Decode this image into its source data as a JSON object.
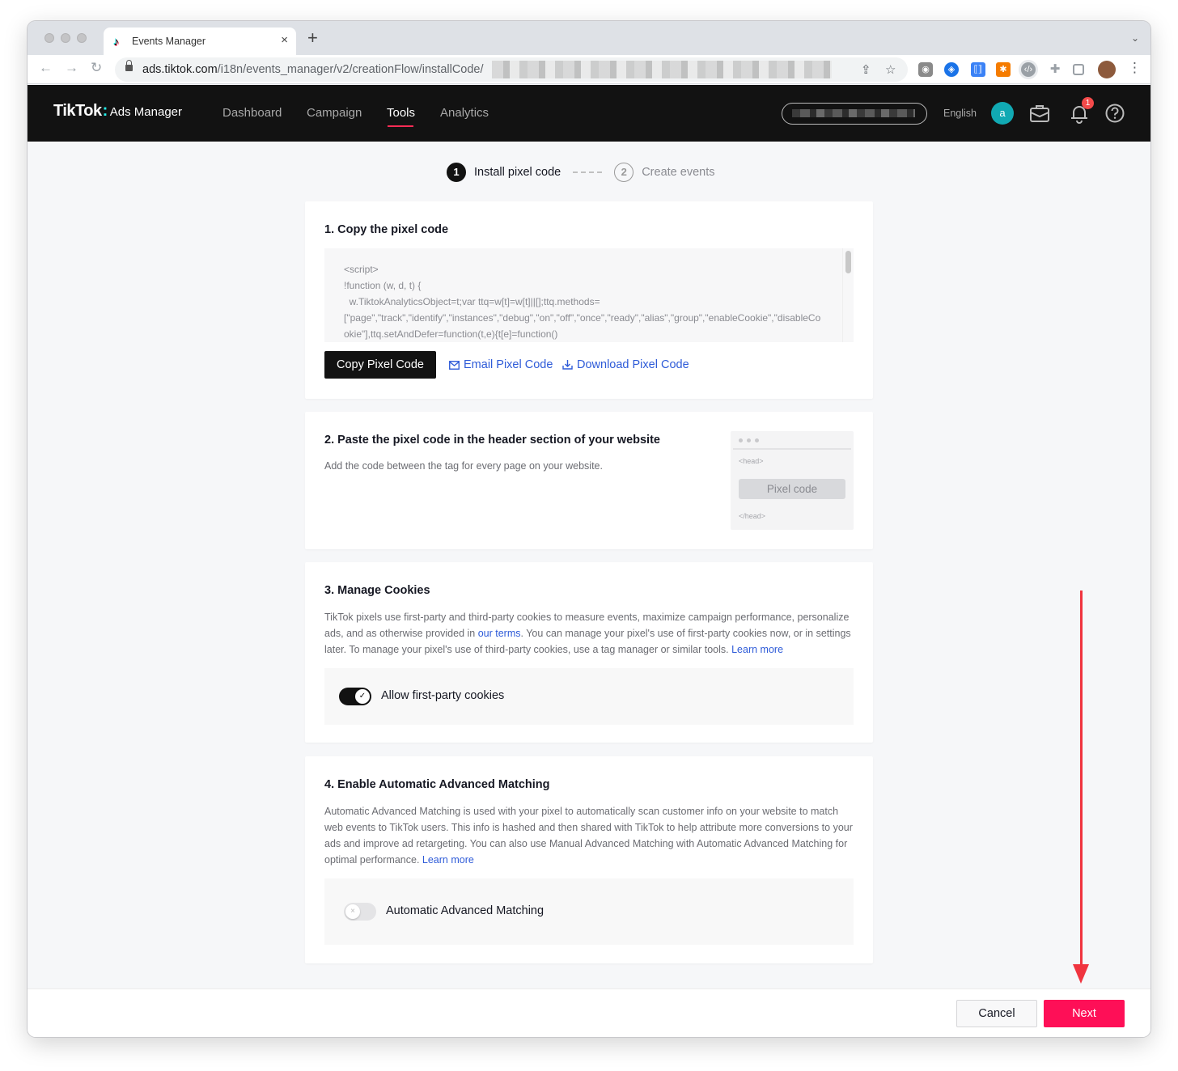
{
  "browser": {
    "tab_title": "Events Manager",
    "tab_close": "×",
    "new_tab": "+",
    "url_domain": "ads.tiktok.com",
    "url_path": "/i18n/events_manager/v2/creationFlow/installCode/",
    "back": "←",
    "forward": "→",
    "reload": "↻",
    "menu": "⋮",
    "caret": "⌄"
  },
  "header": {
    "logo_main": "TikTok",
    "logo_colon": ":",
    "logo_sub": "Ads Manager",
    "nav": [
      {
        "label": "Dashboard",
        "active": false
      },
      {
        "label": "Campaign",
        "active": false
      },
      {
        "label": "Tools",
        "active": true
      },
      {
        "label": "Analytics",
        "active": false
      }
    ],
    "language": "English",
    "avatar_letter": "a",
    "notification_count": "1",
    "accent_color": "#fe2c55"
  },
  "steps": [
    {
      "number": "1",
      "label": "Install pixel code",
      "active": true
    },
    {
      "number": "2",
      "label": "Create events",
      "active": false
    }
  ],
  "section1": {
    "title": "1. Copy the pixel code",
    "code": "<script>\n!function (w, d, t) {\n  w.TiktokAnalyticsObject=t;var ttq=w[t]=w[t]||[];ttq.methods=\n[\"page\",\"track\",\"identify\",\"instances\",\"debug\",\"on\",\"off\",\"once\",\"ready\",\"alias\",\"group\",\"enableCookie\",\"disableCookie\"],ttq.setAndDefer=function(t,e){t[e]=function()",
    "copy_button": "Copy Pixel Code",
    "email_link": "Email Pixel Code",
    "download_link": "Download Pixel Code"
  },
  "section2": {
    "title": "2. Paste the pixel code in the header section of your website",
    "description": "Add the code between the tag for every page on your website.",
    "mock_head_open": "<head>",
    "mock_pixel_label": "Pixel code",
    "mock_head_close": "</head>"
  },
  "section3": {
    "title": "3. Manage Cookies",
    "desc_part1": "TikTok pixels use first-party and third-party cookies to measure events, maximize campaign performance, personalize ads, and as otherwise provided in ",
    "terms_link": "our terms",
    "desc_part2": ". You can manage your pixel's use of first-party cookies now, or in settings later. To manage your pixel's use of third-party cookies, use a tag manager or similar tools. ",
    "learn_more": "Learn more",
    "toggle_label": "Allow first-party cookies",
    "toggle_on": true,
    "toggle_knob_on": "✓"
  },
  "section4": {
    "title": "4. Enable Automatic Advanced Matching",
    "desc": "Automatic Advanced Matching is used with your pixel to automatically scan customer info on your website to match web events to TikTok users. This info is hashed and then shared with TikTok to help attribute more conversions to your ads and improve ad retargeting. You can also use Manual Advanced Matching with Automatic Advanced Matching for optimal performance. ",
    "learn_more": "Learn more",
    "toggle_label": "Automatic Advanced Matching",
    "toggle_on": false,
    "toggle_knob_off": "×"
  },
  "footer": {
    "cancel": "Cancel",
    "next": "Next",
    "next_color": "#fe0f57"
  },
  "annotation": {
    "arrow_color": "#f0343f"
  }
}
